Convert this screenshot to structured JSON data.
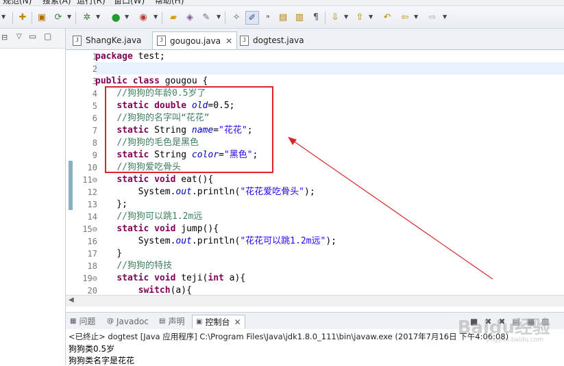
{
  "menubar": {
    "items": [
      "规范(N)",
      "搜索(A)",
      "运行(R)",
      "窗口(W)",
      "帮助(H)"
    ]
  },
  "toolbar": {
    "icons": [
      "new-icon",
      "save-icon",
      "debug-icon",
      "run-icon",
      "external-tools-icon",
      "open-type-icon",
      "search-icon",
      "pencil-icon",
      "annotation-icon",
      "back-icon",
      "forward-icon"
    ]
  },
  "editor": {
    "tabs": [
      {
        "label": "ShangKe.java",
        "active": false
      },
      {
        "label": "gougou.java",
        "active": true
      },
      {
        "label": "dogtest.java",
        "active": false
      }
    ],
    "lines": [
      {
        "n": "1",
        "html": "<span class='kw'>package</span> test;"
      },
      {
        "n": "2",
        "html": ""
      },
      {
        "n": "3",
        "html": "<span class='kw'>public class</span> gougou {"
      },
      {
        "n": "4",
        "html": "    <span class='cm'>//狗狗的年龄0.5岁了</span>"
      },
      {
        "n": "5",
        "html": "    <span class='kw'>static double</span> <span class='fld'>old</span>=0.5;"
      },
      {
        "n": "6",
        "html": "    <span class='cm'>//狗狗的名字叫“花花”</span>"
      },
      {
        "n": "7",
        "html": "    <span class='kw'>static</span> String <span class='fld'>name</span>=<span class='str'>\"花花\"</span>;"
      },
      {
        "n": "8",
        "html": "    <span class='cm'>//狗狗的毛色是黑色</span>"
      },
      {
        "n": "9",
        "html": "    <span class='kw'>static</span> String <span class='fld'>color</span>=<span class='str'>\"黑色\"</span>;"
      },
      {
        "n": "10",
        "html": "    <span class='cm'>//狗狗爱吃骨头</span>"
      },
      {
        "n": "11⊖",
        "html": "    <span class='kw'>static void</span> eat(){"
      },
      {
        "n": "12",
        "html": "        System.<span class='fld'>out</span>.println(<span class='str'>\"花花爱吃骨头\"</span>);"
      },
      {
        "n": "13",
        "html": "    };"
      },
      {
        "n": "14",
        "html": "    <span class='cm'>//狗狗可以跳1.2m远</span>"
      },
      {
        "n": "15⊖",
        "html": "    <span class='kw'>static void</span> jump(){"
      },
      {
        "n": "16",
        "html": "        System.<span class='fld'>out</span>.println(<span class='str'>\"花花可以跳1.2m远\"</span>);"
      },
      {
        "n": "17",
        "html": "    }"
      },
      {
        "n": "18",
        "html": "    <span class='cm'>//狗狗的特技</span>"
      },
      {
        "n": "19⊖",
        "html": "    <span class='kw'>static void</span> teji(<span class='kw'>int</span> a){"
      },
      {
        "n": "20",
        "html": "        <span class='kw'>switch</span>(a){"
      }
    ]
  },
  "console": {
    "tabs": [
      {
        "label": "问题",
        "icon": "problems-icon",
        "active": false
      },
      {
        "label": "Javadoc",
        "icon": "javadoc-icon",
        "active": false
      },
      {
        "label": "声明",
        "icon": "declaration-icon",
        "active": false
      },
      {
        "label": "控制台",
        "icon": "console-icon",
        "active": true
      }
    ],
    "status": "<已终止> dogtest [Java 应用程序] C:\\Program Files\\Java\\jdk1.8.0_111\\bin\\javaw.exe (2017年7月16日 下午4:06:08)",
    "output": [
      "狗狗类0.5岁",
      "狗狗类名字是花花"
    ]
  },
  "watermark": {
    "text": "Baidu经验",
    "sub": "jingyan.baidu.com"
  },
  "colors": {
    "annotation": "#d9262c",
    "keyword": "#7f0055",
    "comment": "#3f7f5f",
    "string": "#2a00ff",
    "field": "#0000c0"
  }
}
